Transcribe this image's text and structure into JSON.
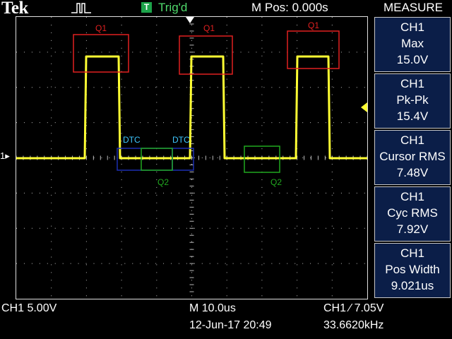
{
  "header": {
    "brand": "Tek",
    "trigger_box": "T",
    "trigger_status": "Trig'd",
    "position": "M Pos: 0.000s"
  },
  "measure": {
    "title": "MEASURE",
    "items": [
      {
        "channel": "CH1",
        "name": "Max",
        "value": "15.0V"
      },
      {
        "channel": "CH1",
        "name": "Pk-Pk",
        "value": "15.4V"
      },
      {
        "channel": "CH1",
        "name": "Cursor RMS",
        "value": "7.48V"
      },
      {
        "channel": "CH1",
        "name": "Cyc RMS",
        "value": "7.92V"
      },
      {
        "channel": "CH1",
        "name": "Pos Width",
        "value": "9.021us"
      }
    ]
  },
  "footer": {
    "ch1_scale": "CH1  5.00V",
    "timebase": "M 10.0us",
    "datetime": "12-Jun-17 20:49",
    "trigger": "CH1 ∕ 7.05V",
    "frequency": "33.6620kHz"
  },
  "markers": {
    "ch1": "1"
  },
  "annotations": [
    {
      "label": "Q1",
      "color": "#e02020"
    },
    {
      "label": "Q1",
      "color": "#e02020"
    },
    {
      "label": "Q1",
      "color": "#e02020"
    },
    {
      "label": "DTC",
      "color": "#3ec7ff"
    },
    {
      "label": "DTC",
      "color": "#3ec7ff"
    },
    {
      "label": "Q2",
      "color": "#21a81f"
    },
    {
      "label": "Q2",
      "color": "#21a81f"
    }
  ],
  "colors": {
    "trace": "#ffff33",
    "grid": "#bbbbbb",
    "panel_bg": "#0b1e48"
  }
}
